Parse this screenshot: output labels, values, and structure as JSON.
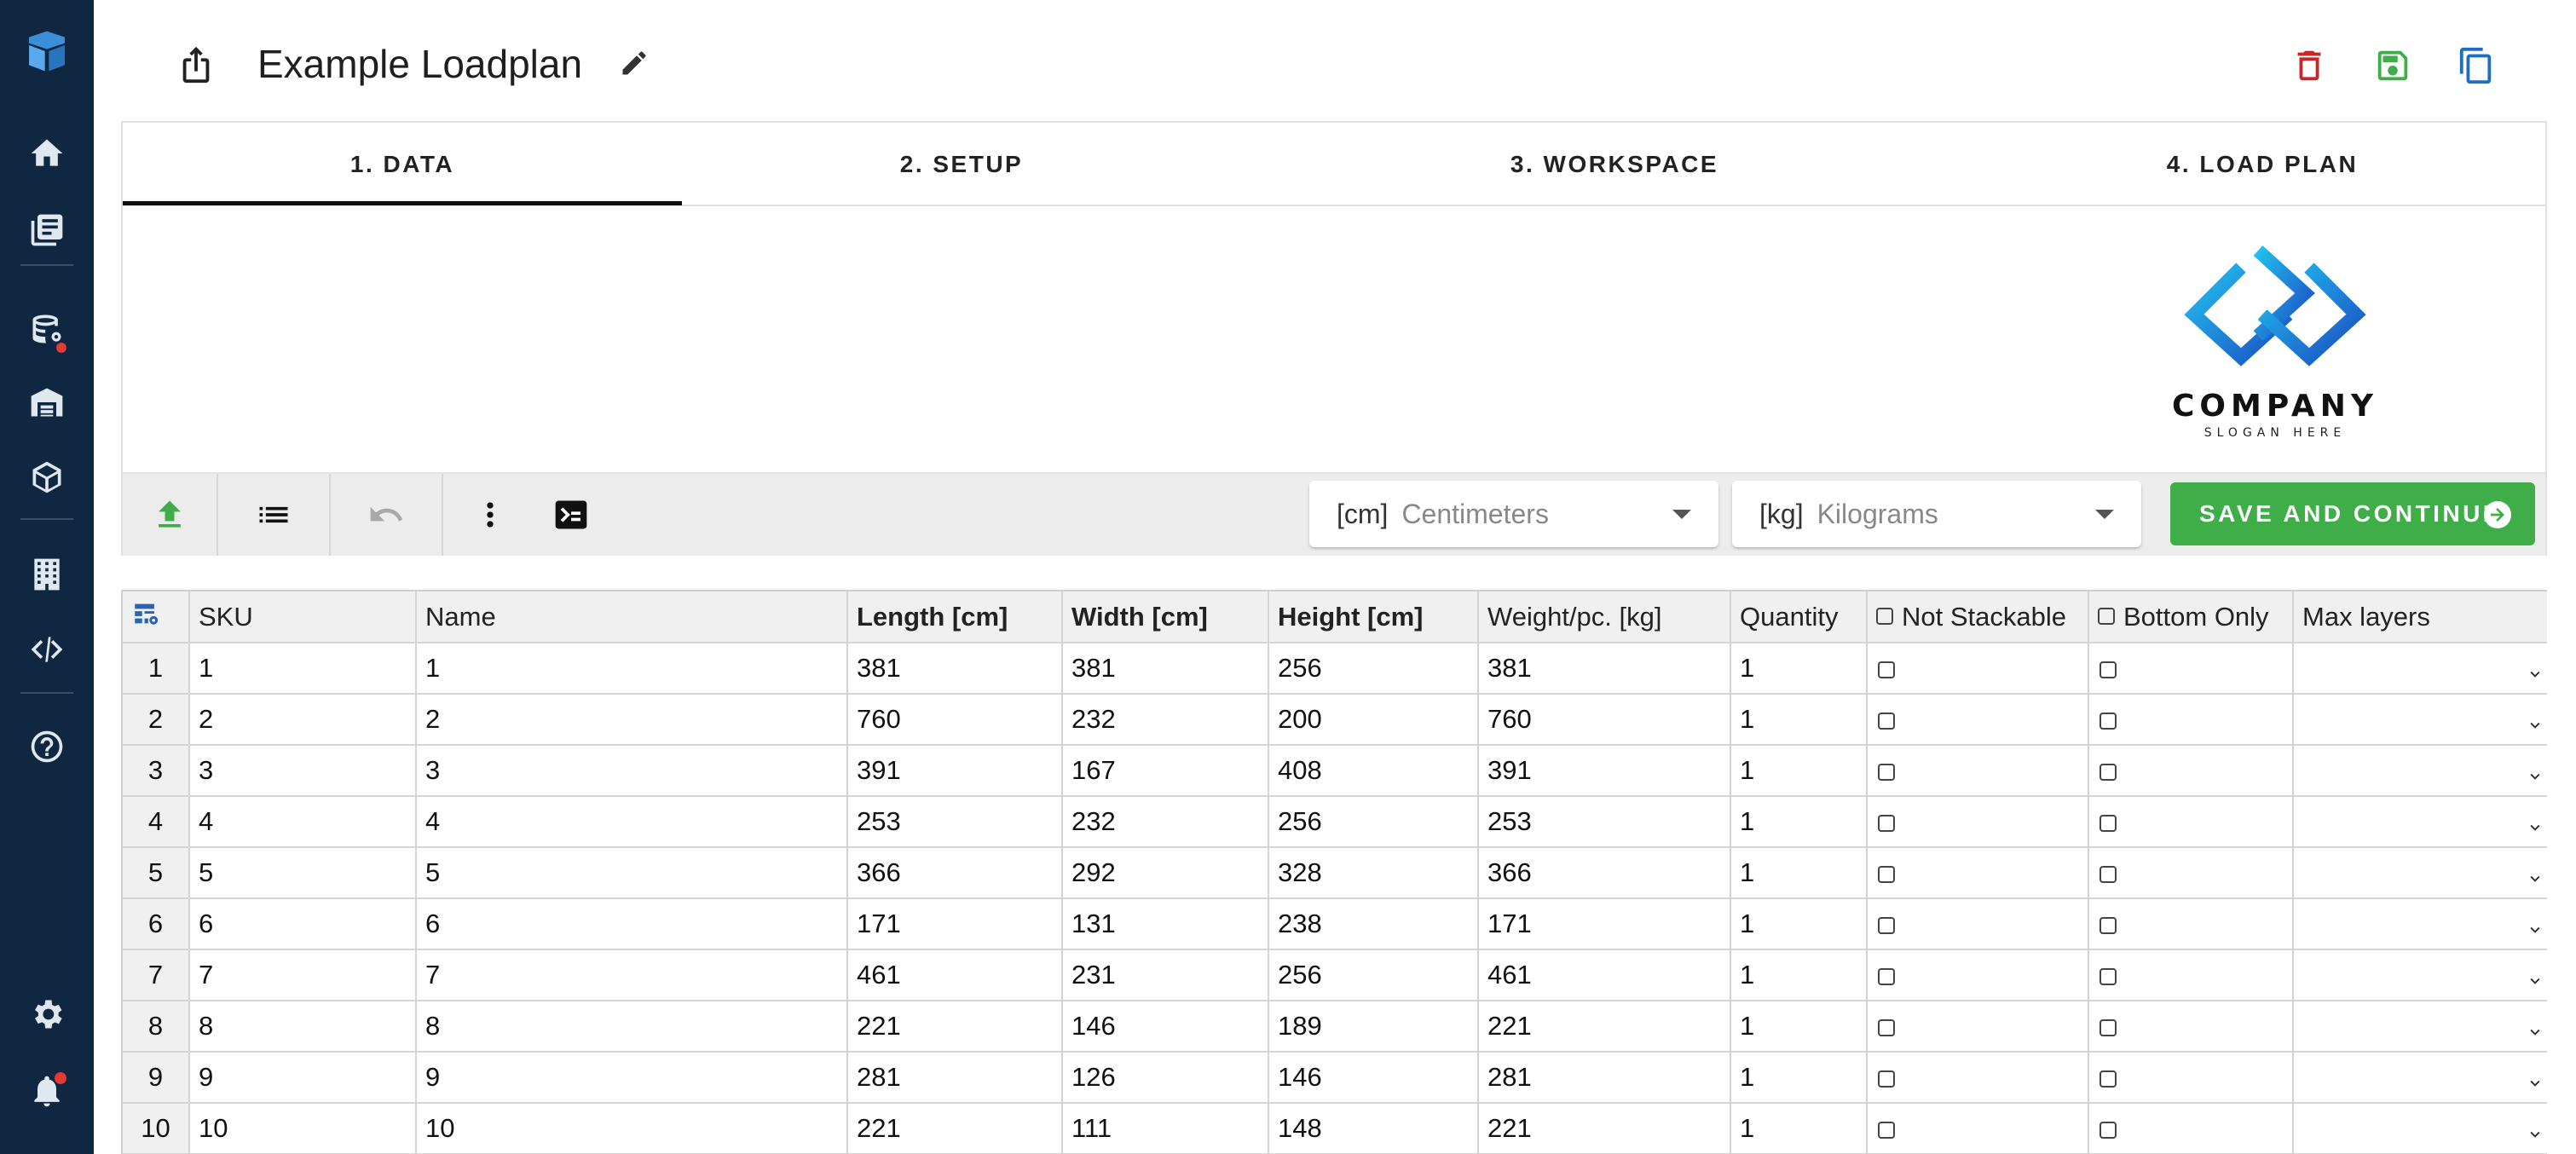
{
  "header": {
    "title": "Example Loadplan"
  },
  "tabs": [
    {
      "label": "1. DATA"
    },
    {
      "label": "2. SETUP"
    },
    {
      "label": "3. WORKSPACE"
    },
    {
      "label": "4. LOAD PLAN"
    }
  ],
  "logo": {
    "text": "COMPANY",
    "slogan": "SLOGAN HERE"
  },
  "toolbar": {
    "length_unit": {
      "unit": "[cm]",
      "value": "Centimeters"
    },
    "weight_unit": {
      "unit": "[kg]",
      "value": "Kilograms"
    },
    "save_label": "SAVE AND CONTINUE"
  },
  "colors": {
    "sidebar": "#0f2740",
    "accent_green": "#3fae49",
    "delete_red": "#c62828",
    "copy_blue": "#1e6fbf"
  },
  "table": {
    "columns": [
      "SKU",
      "Name",
      "Length [cm]",
      "Width [cm]",
      "Height [cm]",
      "Weight/pc. [kg]",
      "Quantity",
      "Not Stackable",
      "Bottom Only",
      "Max layers"
    ],
    "rows": [
      {
        "num": "1",
        "sku": "1",
        "name": "1",
        "length": "381",
        "width": "381",
        "height": "256",
        "weight": "381",
        "qty": "1"
      },
      {
        "num": "2",
        "sku": "2",
        "name": "2",
        "length": "760",
        "width": "232",
        "height": "200",
        "weight": "760",
        "qty": "1"
      },
      {
        "num": "3",
        "sku": "3",
        "name": "3",
        "length": "391",
        "width": "167",
        "height": "408",
        "weight": "391",
        "qty": "1"
      },
      {
        "num": "4",
        "sku": "4",
        "name": "4",
        "length": "253",
        "width": "232",
        "height": "256",
        "weight": "253",
        "qty": "1"
      },
      {
        "num": "5",
        "sku": "5",
        "name": "5",
        "length": "366",
        "width": "292",
        "height": "328",
        "weight": "366",
        "qty": "1"
      },
      {
        "num": "6",
        "sku": "6",
        "name": "6",
        "length": "171",
        "width": "131",
        "height": "238",
        "weight": "171",
        "qty": "1"
      },
      {
        "num": "7",
        "sku": "7",
        "name": "7",
        "length": "461",
        "width": "231",
        "height": "256",
        "weight": "461",
        "qty": "1"
      },
      {
        "num": "8",
        "sku": "8",
        "name": "8",
        "length": "221",
        "width": "146",
        "height": "189",
        "weight": "221",
        "qty": "1"
      },
      {
        "num": "9",
        "sku": "9",
        "name": "9",
        "length": "281",
        "width": "126",
        "height": "146",
        "weight": "281",
        "qty": "1"
      },
      {
        "num": "10",
        "sku": "10",
        "name": "10",
        "length": "221",
        "width": "111",
        "height": "148",
        "weight": "221",
        "qty": "1"
      }
    ]
  }
}
